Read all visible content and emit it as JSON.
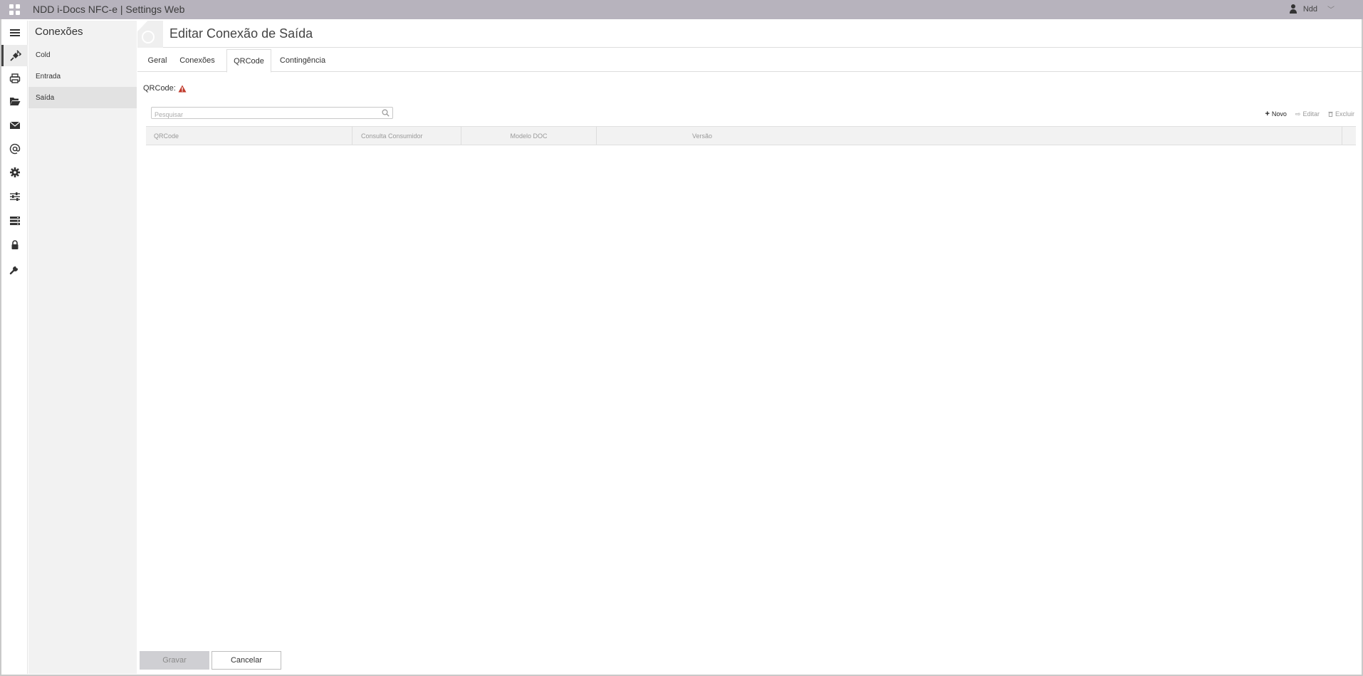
{
  "app": {
    "title": "NDD i-Docs NFC-e | Settings Web"
  },
  "user": {
    "name": "Ndd"
  },
  "rail": {
    "items": [
      {
        "icon": "hamburger-menu-icon"
      },
      {
        "icon": "plug-icon",
        "active": true
      },
      {
        "icon": "printer-icon"
      },
      {
        "icon": "folder-open-icon"
      },
      {
        "icon": "envelope-icon"
      },
      {
        "icon": "at-sign-icon"
      },
      {
        "icon": "gear-icon"
      },
      {
        "icon": "sliders-icon"
      },
      {
        "icon": "server-list-icon"
      },
      {
        "icon": "lock-icon"
      },
      {
        "icon": "wrench-icon"
      }
    ]
  },
  "sidebar": {
    "title": "Conexões",
    "items": [
      {
        "label": "Cold"
      },
      {
        "label": "Entrada"
      },
      {
        "label": "Saída",
        "active": true
      }
    ]
  },
  "page": {
    "title": "Editar Conexão de Saída"
  },
  "tabs": [
    {
      "label": "Geral"
    },
    {
      "label": "Conexões"
    },
    {
      "label": "QRCode",
      "active": true
    },
    {
      "label": "Contingência"
    }
  ],
  "qrcode": {
    "label": "QRCode:",
    "warning_color": "#c0392b"
  },
  "search": {
    "placeholder": "Pesquisar"
  },
  "actions": {
    "new_label": "Novo",
    "edit_label": "Editar",
    "delete_label": "Excluir"
  },
  "grid": {
    "columns": [
      "QRCode",
      "Consulta Consumidor",
      "Modelo DOC",
      "Versão"
    ],
    "rows": []
  },
  "footer": {
    "save_label": "Gravar",
    "cancel_label": "Cancelar"
  }
}
